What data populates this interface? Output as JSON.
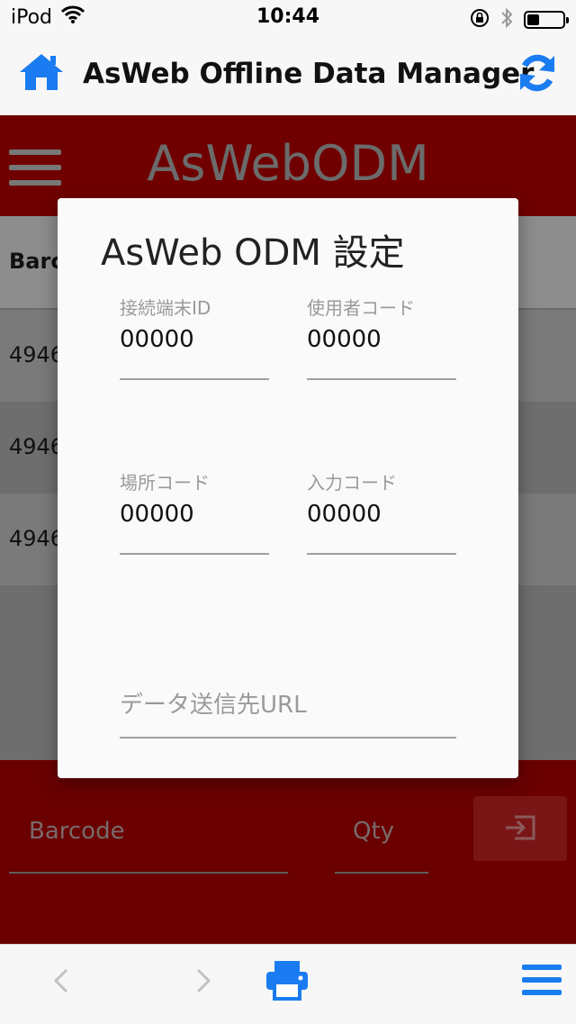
{
  "status_bar": {
    "carrier": "iPod",
    "time": "10:44",
    "battery_level": 0.35
  },
  "nav": {
    "title": "AsWeb Offline Data Manager",
    "home_icon": "home-icon",
    "refresh_icon": "refresh-icon",
    "accent": "#1a7cf0"
  },
  "app": {
    "title": "AsWebODM",
    "header_color": "#700000"
  },
  "table": {
    "header_barcode": "Barc",
    "rows": [
      "4946",
      "4946",
      "4946"
    ]
  },
  "entry": {
    "barcode_placeholder": "Barcode",
    "qty_placeholder": "Qty",
    "enter_icon": "enter-icon"
  },
  "dialog": {
    "title": "AsWeb ODM 設定",
    "fields": [
      {
        "label": "接続端末ID",
        "value": "00000"
      },
      {
        "label": "使用者コード",
        "value": "00000"
      },
      {
        "label": "場所コード",
        "value": "00000"
      },
      {
        "label": "入力コード",
        "value": "00000"
      }
    ],
    "url_placeholder": "データ送信先URL"
  },
  "toolbar": {
    "back_icon": "chevron-left-icon",
    "forward_icon": "chevron-right-icon",
    "print_icon": "print-icon",
    "menu_icon": "menu-icon"
  }
}
